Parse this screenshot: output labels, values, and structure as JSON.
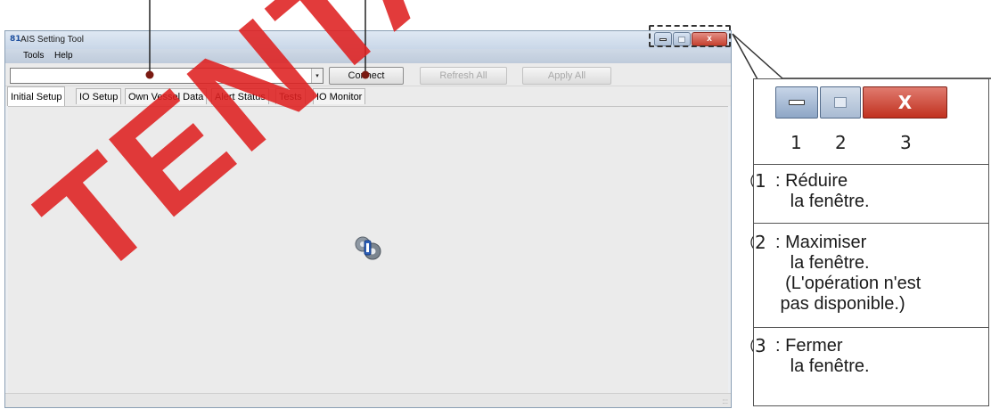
{
  "window": {
    "title": "AIS Setting Tool",
    "app_icon": "81",
    "caption_buttons": [
      "minimize-icon",
      "maximize-icon",
      "close-icon"
    ],
    "close_glyph": "x"
  },
  "menu": {
    "items": [
      "Tools",
      "Help"
    ]
  },
  "toolbar": {
    "combo_value": "",
    "combo_arrow": "▾",
    "connect_label": "Connect",
    "refresh_label": "Refresh All",
    "apply_label": "Apply All"
  },
  "tabs": [
    "Initial Setup",
    "IO Setup",
    "Own Vessel Data",
    "Alert Status",
    "Tests",
    "IO Monitor"
  ],
  "active_tab": "Initial Setup",
  "content": {
    "loading_icon": "gear-icon"
  },
  "status": {
    "grip": ":::"
  },
  "callout": {
    "close_glyph": "X",
    "numbers": [
      "1",
      "2",
      "3"
    ],
    "legend": [
      {
        "num": "1",
        "text": ": Réduire\n   la fenêtre."
      },
      {
        "num": "2",
        "text": ": Maximiser\n   la fenêtre.\n  (L'opération n'est\n pas disponible.)"
      },
      {
        "num": "3",
        "text": ": Fermer\n   la fenêtre."
      }
    ]
  },
  "watermark": "TENTATIVE",
  "colors": {
    "watermark": "#de2020",
    "close_button": "#c4402f",
    "callout_dot": "#7a1a12"
  }
}
